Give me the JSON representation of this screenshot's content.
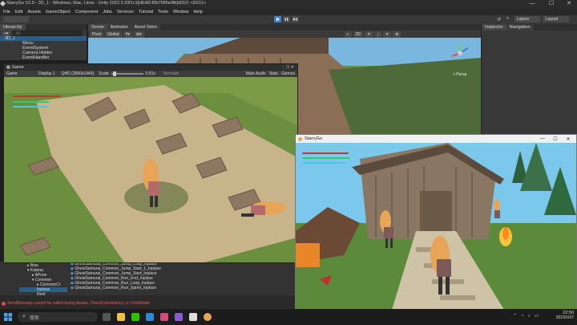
{
  "window": {
    "title": "StarryGo V2.0 - 3D_1 - Windows, Mac, Linux - Unity 2022.3.20f1c1[HEAD:f0b7f3f5e0fb]d31f1 <DX11>",
    "minimize": "—",
    "maximize": "☐",
    "close": "✕"
  },
  "menu": [
    "File",
    "Edit",
    "Assets",
    "GameObject",
    "Component",
    "Jobs",
    "Services",
    "Tutorial",
    "Tools",
    "Window",
    "Help"
  ],
  "toolbar": {
    "layers": "Layers",
    "layout": "Layout"
  },
  "hierarchy": {
    "tab": "Hierarchy",
    "search_placeholder": "All",
    "items": [
      {
        "label": "3D_1"
      },
      {
        "label": "Menu"
      },
      {
        "label": "EventSystem"
      },
      {
        "label": "Camera Holder"
      },
      {
        "label": "EventHandler"
      }
    ]
  },
  "scene": {
    "tabs": [
      "Scene",
      "Animator",
      "Asset Store"
    ],
    "pivot": "Pivot",
    "global": "Global",
    "mode": "2D",
    "persp": "< Persp"
  },
  "inspector": {
    "tabs": [
      "Inspector",
      "Navigation"
    ]
  },
  "game": {
    "window_title": "Game",
    "display_label": "Game",
    "display": "Display 1",
    "resolution": "QHD (2560x1440)",
    "scale_label": "Scale",
    "scale_value": "0.51x",
    "normally": "Normally",
    "mute": "Mute Audio",
    "stats": "Stats",
    "gizmos": "Gizmos"
  },
  "project": {
    "folders": [
      {
        "label": "Bow"
      },
      {
        "label": "Katana"
      },
      {
        "label": "APose"
      },
      {
        "label": "Common"
      },
      {
        "label": "CommonCr"
      },
      {
        "label": "Inplace"
      },
      {
        "label": "Root"
      }
    ],
    "files": [
      {
        "label": "GhostSamurai_Common_Jump_Loop_Inplace"
      },
      {
        "label": "GhostSamurai_Common_Jump_Start_1_Inplace"
      },
      {
        "label": "GhostSamurai_Common_Jump_Start_Inplace"
      },
      {
        "label": "GhostSamurai_Common_Run_End_Inplace"
      },
      {
        "label": "GhostSamurai_Common_Run_Loop_Inplace"
      },
      {
        "label": "GhostSamurai_Common_Run_Sprint_Inplace"
      }
    ]
  },
  "status": {
    "message": "SendMessage cannot be called during Awake, CheckConsistency, or OnValidate"
  },
  "player": {
    "title": "StarryGo",
    "minimize": "—",
    "maximize": "☐",
    "close": "✕"
  },
  "taskbar": {
    "search_placeholder": "搜索",
    "time": "22:50",
    "date": "2023/10/7"
  },
  "colors": {
    "hp_red": "#c0392b",
    "hp_green": "#2ecc71",
    "hp_cyan": "#48c9e0",
    "unity_blue": "#3d7fd6"
  }
}
